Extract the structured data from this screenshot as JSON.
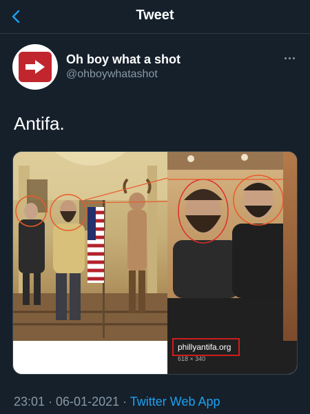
{
  "header": {
    "title": "Tweet"
  },
  "tweet": {
    "author_name": "Oh boy what a shot",
    "author_handle": "@ohboywhatashot",
    "text": "Antifa.",
    "media": {
      "caption_site": "phillyantifa.org",
      "caption_dimensions": "618 × 340"
    },
    "timestamp": "23:01 · 06-01-2021",
    "separator": " · ",
    "source": "Twitter Web App"
  },
  "icons": {
    "back": "chevron-left-icon",
    "more": "more-dots-icon",
    "avatar_logo": "arrow-right-icon"
  },
  "colors": {
    "background": "#15202b",
    "accent": "#1da1f2",
    "secondary_text": "#8899a6",
    "highlight": "#d01d1d"
  }
}
